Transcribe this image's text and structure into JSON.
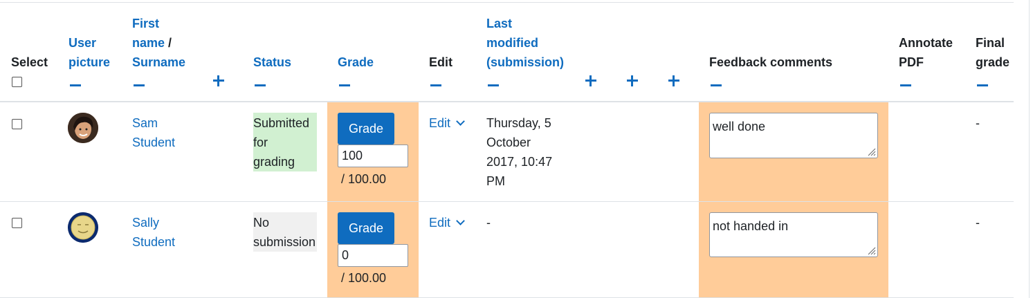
{
  "headers": {
    "select": "Select",
    "user_picture_1": "User",
    "user_picture_2": "picture",
    "first_name": "First",
    "name": "name",
    "slash": "/",
    "surname": "Surname",
    "status": "Status",
    "grade": "Grade",
    "edit": "Edit",
    "last_1": "Last",
    "last_2": "modified",
    "last_3": "(submission)",
    "feedback": "Feedback comments",
    "annotate_1": "Annotate",
    "annotate_2": "PDF",
    "final_1": "Final",
    "final_2": "grade"
  },
  "rows": [
    {
      "first_name": "Sam",
      "last_name": "Student",
      "status_1": "Submitted",
      "status_2": "for",
      "status_3": "grading",
      "grade_button": "Grade",
      "grade_value": "100",
      "grade_max": "/ 100.00",
      "edit_label": "Edit",
      "modified_1": "Thursday, 5",
      "modified_2": "October",
      "modified_3": "2017, 10:47",
      "modified_4": "PM",
      "feedback": "well done",
      "final_grade": "-"
    },
    {
      "first_name": "Sally",
      "last_name": "Student",
      "status_1": "No",
      "status_2": "submission",
      "grade_button": "Grade",
      "grade_value": "0",
      "grade_max": "/ 100.00",
      "edit_label": "Edit",
      "modified_1": "-",
      "feedback": "not handed in",
      "final_grade": "-"
    }
  ],
  "colors": {
    "link": "#0f6cbf",
    "grade_column_bg": "#ffcc99",
    "submitted_bg": "#d1f0d1",
    "no_submission_bg": "#f0f0f0"
  }
}
